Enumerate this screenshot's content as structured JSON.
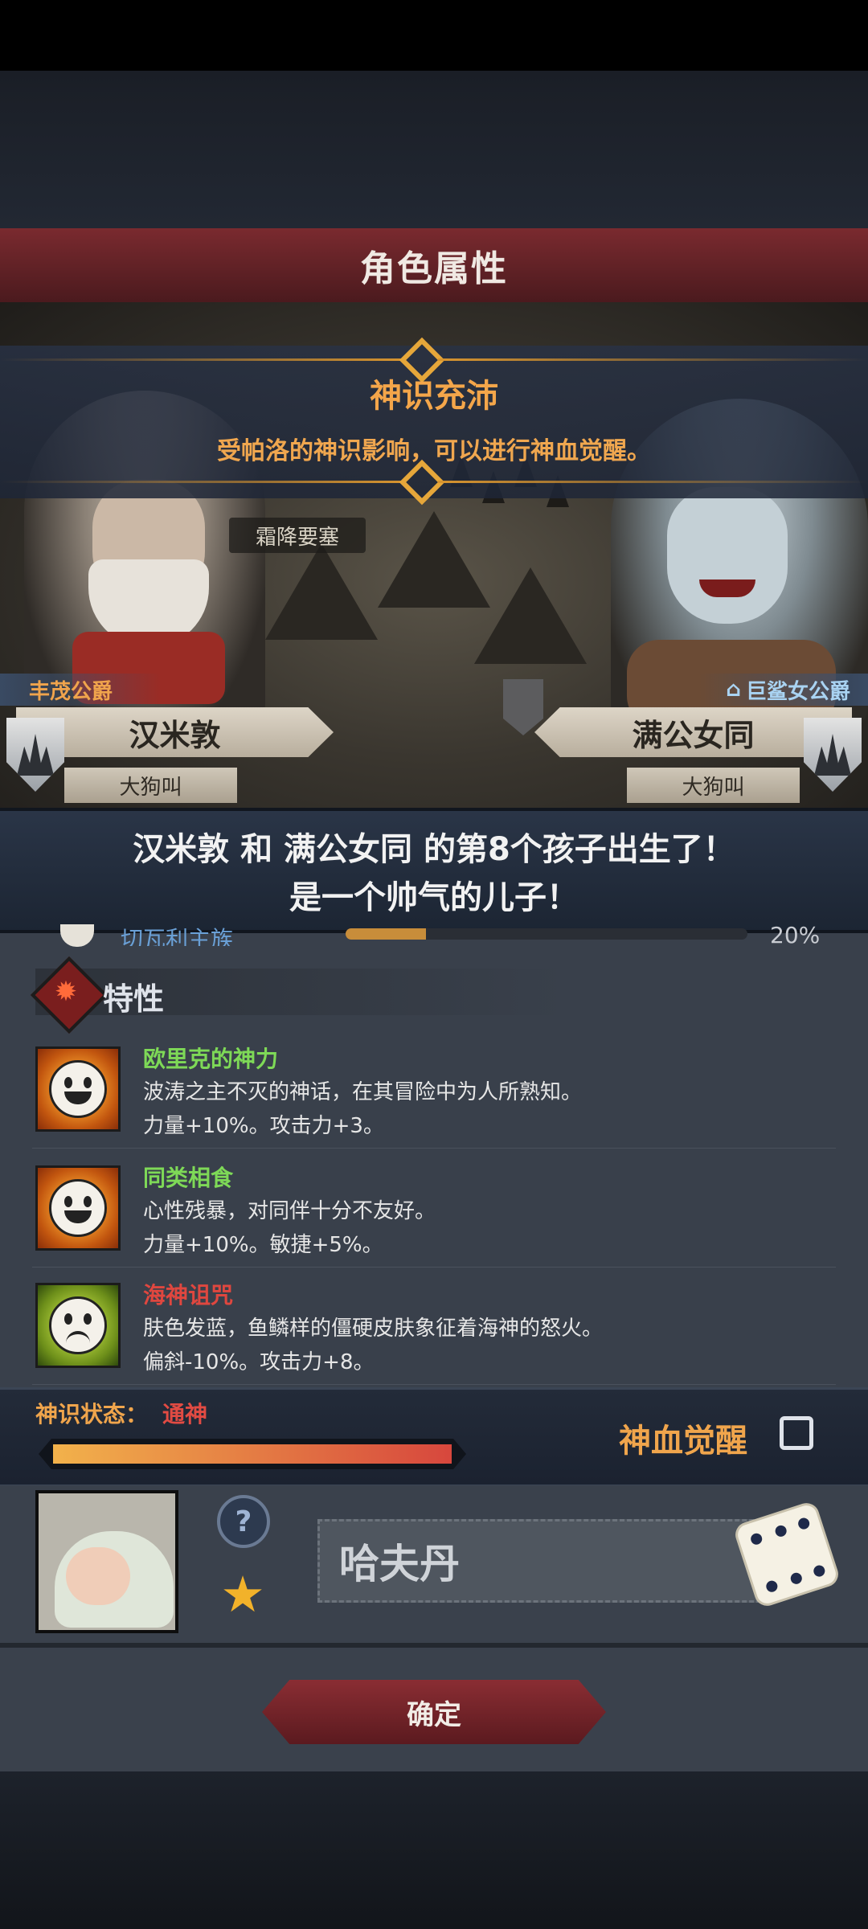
{
  "dialog": {
    "title": "角色属性"
  },
  "event": {
    "title": "神识充沛",
    "description": "受帕洛的神识影响，可以进行神血觉醒。"
  },
  "map": {
    "location_label": "霜降要塞"
  },
  "father": {
    "rank": "丰茂公爵",
    "name": "汉米敦",
    "subtitle": "大狗叫"
  },
  "mother": {
    "rank": "巨鲨女公爵",
    "name": "满公女同",
    "subtitle": "大狗叫"
  },
  "birth_message": {
    "line1": "汉米敦 和 满公女同 的第8个孩子出生了！",
    "line2": "是一个帅气的儿子！"
  },
  "partial_row": {
    "label": "切瓦利主族",
    "percent": "20%",
    "progress": 0.2
  },
  "traits": {
    "header": "特性",
    "items": [
      {
        "name": "欧里克的神力",
        "name_color": "#7ed957",
        "icon": "happy-face-icon",
        "desc": "波涛之主不灭的神话，在其冒险中为人所熟知。",
        "effect": "力量+10%。攻击力+3。"
      },
      {
        "name": "同类相食",
        "name_color": "#7ed957",
        "icon": "happy-face-icon",
        "desc": "心性残暴，对同伴十分不友好。",
        "effect": "力量+10%。敏捷+5%。"
      },
      {
        "name": "海神诅咒",
        "name_color": "#e0473f",
        "icon": "sad-face-icon",
        "desc": "肤色发蓝，鱼鳞样的僵硬皮肤象征着海神的怒火。",
        "effect": "偏斜-10%。攻击力+8。"
      }
    ]
  },
  "divine_state": {
    "label": "神识状态：",
    "value": "通神",
    "progress": 1.0,
    "awaken_label": "神血觉醒",
    "awaken_checked": false
  },
  "child": {
    "name": "哈夫丹"
  },
  "confirm_label": "确定"
}
